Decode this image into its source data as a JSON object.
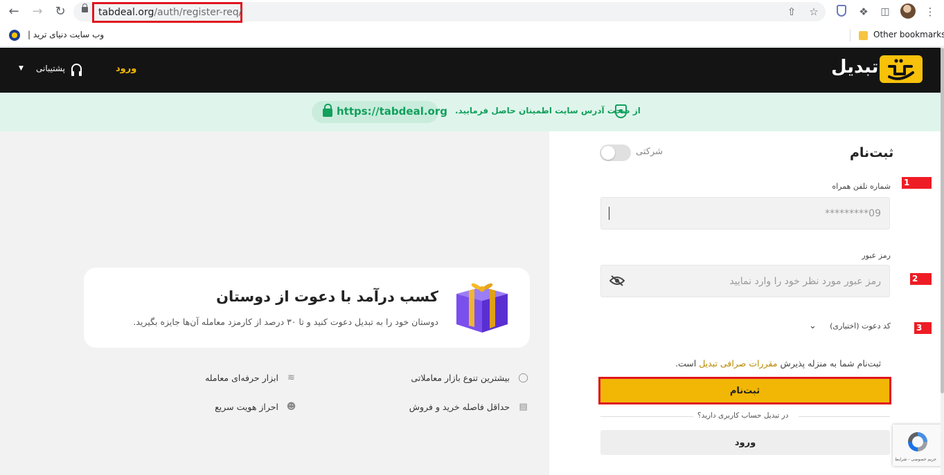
{
  "browser": {
    "url_host": "tabdeal.org",
    "url_path": "/auth/register-req/",
    "bookmark_label": "وب سایت دنیای ترید |",
    "other_bookmarks": "Other bookmarks",
    "icons": [
      "back-arrow",
      "forward-arrow",
      "reload",
      "share",
      "star",
      "extension-shield",
      "puzzle",
      "sidebar",
      "profile",
      "kebab-menu"
    ]
  },
  "header": {
    "logo_text": "تبدیل",
    "login": "ورود",
    "support": "پشتیبانی",
    "accent_color": "#f2b705"
  },
  "security_banner": {
    "message": "از صحت آدرس سایت اطمینان حاصل فرمایید.",
    "url": "https://tabdeal.org",
    "color": "#12a05c"
  },
  "promo": {
    "title": "کسب درآمد با دعوت از دوستان",
    "subtitle": "دوستان خود را به تبدیل دعوت کنید و تا ۳۰ درصد از کارمزد معامله آن‌ها جایزه بگیرید.",
    "features": [
      {
        "label": "بیشترین تنوع بازار معاملاتی",
        "icon": "toggle-icon"
      },
      {
        "label": "ابزار حرفه‌ای معامله",
        "icon": "chart-line-icon"
      },
      {
        "label": "حداقل فاصله خرید و فروش",
        "icon": "card-icon"
      },
      {
        "label": "احراز هویت سریع",
        "icon": "user-check-icon"
      }
    ]
  },
  "form": {
    "title": "ثبت‌نام",
    "company_toggle_label": "شرکتی",
    "phone_label": "شماره تلفن همراه",
    "phone_placeholder": "09*********",
    "password_label": "رمز عبور",
    "password_placeholder": "رمز عبور مورد نظر خود را وارد نمایید",
    "invite_label": "کد دعوت (اختیاری)",
    "terms_prefix": "ثبت‌نام شما به منزله پذیرش",
    "terms_link": "مقررات صرافی تبدیل",
    "terms_suffix": "است.",
    "register_button": "ثبت‌نام",
    "have_account": "در تبدیل حساب کاربری دارید؟",
    "login_button": "ورود"
  },
  "annotations": {
    "markers": [
      "1",
      "2",
      "3"
    ],
    "highlight_color": "#e0151f"
  },
  "recaptcha": {
    "text": "حریم خصوصی - شرایط"
  }
}
